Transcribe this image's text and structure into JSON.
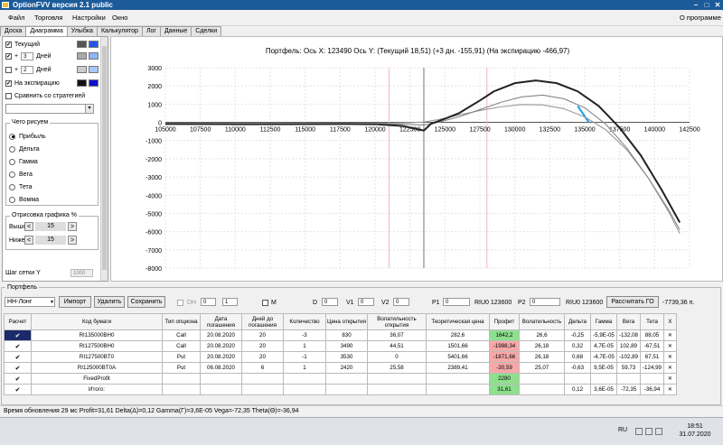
{
  "window": {
    "title": "OptionFVV версия 2.1 public"
  },
  "menu": {
    "items": [
      "Файл",
      "Торговля",
      "Настройки",
      "Окно"
    ],
    "right": "О программе"
  },
  "tabs": [
    "Доска",
    "Диаграмма",
    "Улыбка",
    "Калькулятор",
    "Лог",
    "Данные",
    "Сделки"
  ],
  "left_panel": {
    "current_label": "Текущий",
    "plus_sign": "+",
    "days_label": "Дней",
    "days1": "3",
    "days2": "2",
    "expiry_label": "На экспирацию",
    "compare_label": "Сравнить со стратегией",
    "what_to_draw_title": "Чего рисуем",
    "radios": [
      "Прибыль",
      "Дельта",
      "Гамма",
      "Вега",
      "Тета",
      "Вомма"
    ],
    "render_title": "Отрисовка графика %",
    "above_label": "Выше",
    "below_label": "Ниже",
    "above_value": "15",
    "below_value": "15",
    "grid_step_label": "Шаг сетки Y",
    "grid_step_value": "1000",
    "colors": {
      "current": [
        "#555555",
        "#2255ee"
      ],
      "plus1": [
        "#aaaaaa",
        "#8fb4ff"
      ],
      "plus2": [
        "#cccccc",
        "#a9c7ff"
      ],
      "expiry": [
        "#111111",
        "#1010cc"
      ]
    }
  },
  "chart_data": {
    "type": "line",
    "title": "Портфель: Ось X: 123490 Ось Y:  (Текущий 18,51)  (+3 дн. -155,91)  (На экспирацию -466,97)",
    "xlim": [
      105000,
      142500
    ],
    "ylim": [
      -8000,
      3000
    ],
    "x_ticks": [
      "105000",
      "107500",
      "110000",
      "112500",
      "115000",
      "117500",
      "120000",
      "122500",
      "125000",
      "127500",
      "130000",
      "132500",
      "135000",
      "137500",
      "140000",
      "142500"
    ],
    "y_ticks": [
      "3000",
      "2000",
      "1000",
      "0",
      "-1000",
      "-2000",
      "-3000",
      "-4000",
      "-5000",
      "-6000",
      "-7000",
      "-8000"
    ],
    "cursor_x": 123490,
    "series": [
      {
        "color": "#222222",
        "x": [
          105000,
          110000,
          115000,
          118000,
          120000,
          122000,
          123490,
          124000,
          125000,
          126000,
          127500,
          128500,
          130000,
          131500,
          133000,
          134500,
          136000,
          137500,
          139000,
          140500,
          141800
        ],
        "y": [
          -90,
          -100,
          -95,
          -90,
          -100,
          -200,
          -450,
          -80,
          200,
          500,
          1200,
          1700,
          2150,
          2300,
          2150,
          1700,
          900,
          -300,
          -1800,
          -3700,
          -5500
        ]
      },
      {
        "color": "#888888",
        "x": [
          105000,
          115000,
          120000,
          122000,
          123490,
          124500,
          126000,
          127500,
          129000,
          130500,
          132000,
          133500,
          135000,
          136500,
          138000,
          139500,
          141000,
          141800
        ],
        "y": [
          -80,
          -80,
          -80,
          -100,
          -150,
          0,
          300,
          700,
          1100,
          1400,
          1500,
          1300,
          800,
          -100,
          -1400,
          -3000,
          -4800,
          -5900
        ]
      },
      {
        "color": "#999999",
        "x": [
          105000,
          115000,
          120000,
          122500,
          123490,
          124500,
          126000,
          127500,
          129000,
          130500,
          132000,
          133500,
          135000,
          136500,
          138000,
          139500,
          141000,
          141800
        ],
        "y": [
          -60,
          -60,
          -60,
          -20,
          20,
          150,
          400,
          650,
          850,
          980,
          960,
          750,
          300,
          -400,
          -1500,
          -3000,
          -4900,
          -6100
        ]
      }
    ]
  },
  "portfolio": {
    "group_label": "Портфель",
    "select_value": "НН-Лонг",
    "import_label": "Импорт",
    "delete_label": "Удалить",
    "save_label": "Сохранить",
    "dh_label": "DH",
    "dh_v1": "0",
    "dh_v2": "1",
    "m_label": "M",
    "d_label": "D",
    "d_value": "0",
    "v1_label": "V1",
    "v1_value": "0",
    "v2_label": "V2",
    "v2_value": "0",
    "p1_label": "P1",
    "p1_value": "0",
    "riu1": "RIU0 123600",
    "p2_label": "P2",
    "p2_value": "0",
    "riu2": "RIU0 123600",
    "calc_label": "Рассчитать ГО",
    "go_value": "-7739,36 п.",
    "headers": [
      "Расчет",
      "Код бумаги",
      "Тип опциона",
      "Дата погашения",
      "Дней до погашения",
      "Количество",
      "Цена открытия",
      "Волатильность открытия",
      "Теоретическая цена",
      "Профит",
      "Волатильность",
      "Дельта",
      "Гамма",
      "Вега",
      "Тета",
      "X"
    ],
    "rows": [
      [
        "✔",
        "RI135000BH0",
        "Call",
        "20.08.2020",
        "20",
        "-3",
        "830",
        "36,07",
        "282,6",
        "1642,2",
        "26,6",
        "-0,25",
        "-5,9E-05",
        "-132,08",
        "88,05",
        "✕"
      ],
      [
        "✔",
        "RI127500BH0",
        "Call",
        "20.08.2020",
        "20",
        "1",
        "3490",
        "44,51",
        "1501,66",
        "-1988,34",
        "26,18",
        "0,32",
        "4,7E-05",
        "102,89",
        "-67,51",
        "✕"
      ],
      [
        "✔",
        "RI127500BT0",
        "Put",
        "20.08.2020",
        "20",
        "-1",
        "3530",
        "0",
        "5401,66",
        "-1871,66",
        "26,18",
        "0,68",
        "-4,7E-05",
        "-102,89",
        "67,51",
        "✕"
      ],
      [
        "✔",
        "RI125000BT0A",
        "Put",
        "06.08.2020",
        "6",
        "1",
        "2420",
        "25,58",
        "2389,41",
        "-30,59",
        "25,07",
        "-0,63",
        "9,5E-05",
        "59,73",
        "-124,99",
        "✕"
      ],
      [
        "✔",
        "FixedProfit",
        "",
        "",
        "",
        "",
        "",
        "",
        "",
        "2280",
        "",
        "",
        "",
        "",
        "",
        "✕"
      ],
      [
        "✔",
        "Итого:",
        "",
        "",
        "",
        "",
        "",
        "",
        "",
        "31,61",
        "",
        "0,12",
        "3,6E-05",
        "-72,35",
        "-36,94",
        "✕"
      ]
    ],
    "profit_colors": [
      "#8ee08e",
      "#f7a8a8",
      "#f7a8a8",
      "#f7a8a8",
      "#8ee08e",
      "#8ee08e"
    ]
  },
  "status": "Время обновления 29 мс  Profit=31,61 Delta(Δ)=0,12 Gamma(Γ)=3,6E-05 Vega=-72,35 Theta(Θ)=-36,94",
  "taskbar": {
    "lang": "RU",
    "time": "18:51",
    "date": "31.07.2020"
  }
}
